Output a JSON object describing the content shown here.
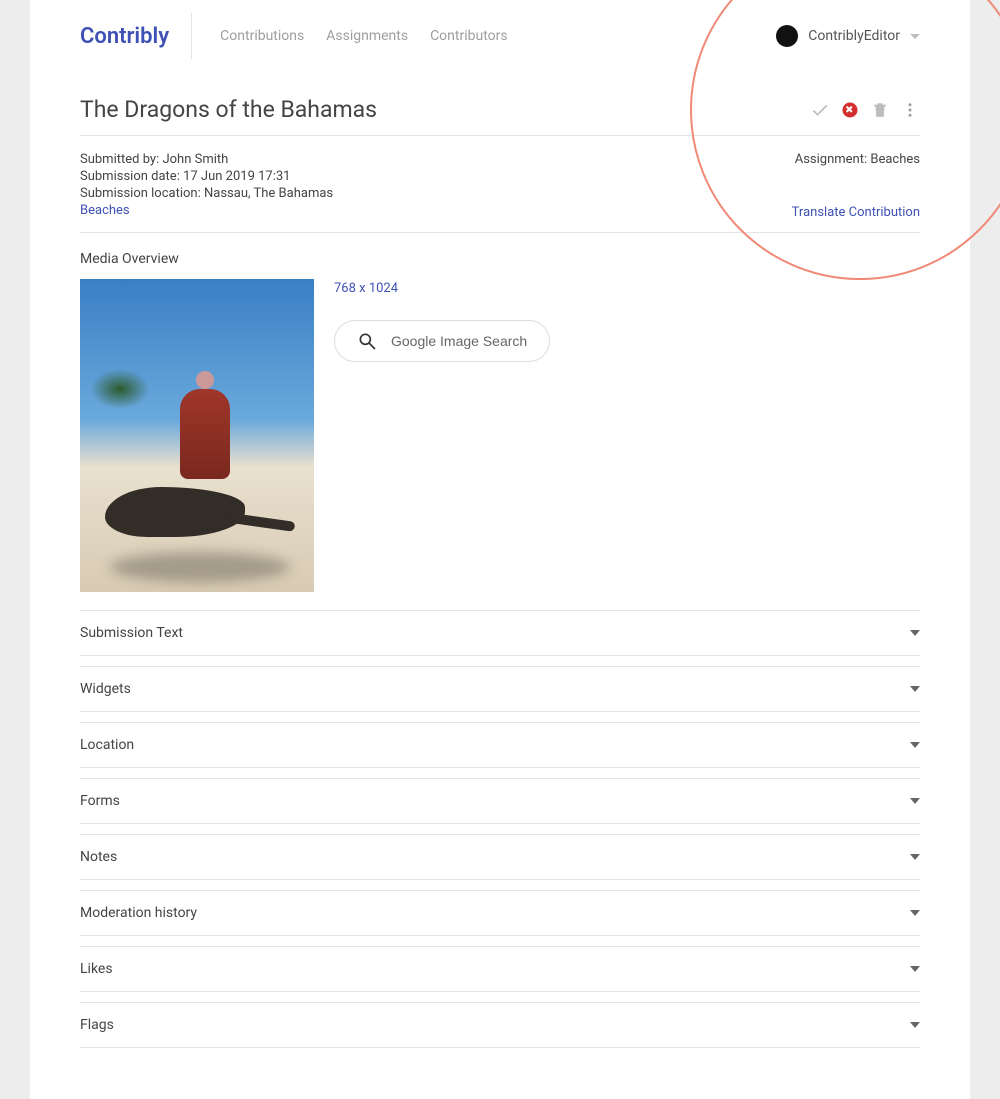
{
  "brand": "Contribly",
  "nav": {
    "contributions": "Contributions",
    "assignments": "Assignments",
    "contributors": "Contributors"
  },
  "user": {
    "name": "ContriblyEditor"
  },
  "page": {
    "title": "The Dragons of the Bahamas"
  },
  "meta": {
    "submitted_by_label": "Submitted by: ",
    "submitted_by": "John Smith",
    "submission_date_label": "Submission date: ",
    "submission_date": "17 Jun 2019 17:31",
    "submission_location_label": "Submission location: ",
    "submission_location": "Nassau, The Bahamas",
    "tag_link": "Beaches",
    "assignment_label": "Assignment: ",
    "assignment_value": "Beaches",
    "translate_link": "Translate Contribution"
  },
  "media": {
    "overview_label": "Media Overview",
    "dimensions": "768 x 1024",
    "google_image_search": "Google Image Search"
  },
  "sections": [
    {
      "label": "Submission Text"
    },
    {
      "label": "Widgets"
    },
    {
      "label": "Location"
    },
    {
      "label": "Forms"
    },
    {
      "label": "Notes"
    },
    {
      "label": "Moderation history"
    },
    {
      "label": "Likes"
    },
    {
      "label": "Flags"
    }
  ]
}
